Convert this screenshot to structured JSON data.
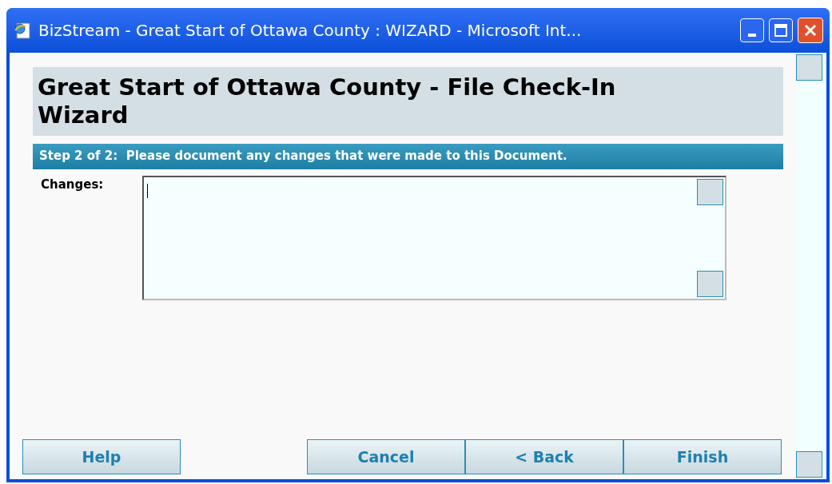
{
  "window": {
    "title": "BizStream - Great Start of Ottawa County : WIZARD - Microsoft Int..."
  },
  "header": {
    "title": "Great Start of Ottawa County - File Check-In Wizard"
  },
  "step": {
    "text": "Step 2 of 2:  Please document any changes that were made to this Document."
  },
  "changes_field": {
    "label": "Changes:",
    "focused": true
  },
  "buttons": [
    {
      "label": "Help",
      "kind": "help"
    },
    {
      "label": "Cancel",
      "kind": "nav"
    },
    {
      "label": "< Back",
      "kind": "nav"
    },
    {
      "label": "Finish",
      "kind": "nav"
    }
  ]
}
